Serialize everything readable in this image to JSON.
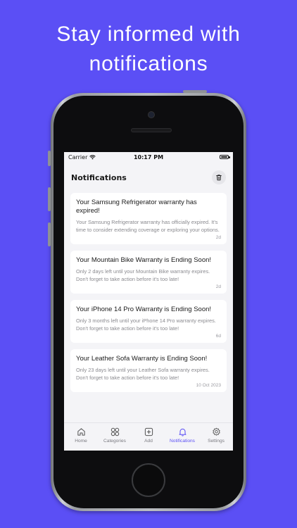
{
  "promo": {
    "headline_line1": "Stay informed with",
    "headline_line2": "notifications"
  },
  "statusbar": {
    "carrier": "Carrier",
    "time": "10:17 PM"
  },
  "header": {
    "title": "Notifications",
    "clear_icon": "trash-icon"
  },
  "notifications": [
    {
      "title": "Your Samsung Refrigerator warranty has expired!",
      "body": "Your Samsung Refrigerator warranty has officially expired. It's time to consider extending coverage or exploring your options.",
      "time": "2d"
    },
    {
      "title": "Your Mountain Bike Warranty is Ending Soon!",
      "body": "Only 2 days left until your Mountain Bike warranty expires. Don't forget to take action before it's too late!",
      "time": "2d"
    },
    {
      "title": "Your iPhone 14 Pro Warranty is Ending Soon!",
      "body": "Only 3 months left until your iPhone 14 Pro warranty expires. Don't forget to take action before it's too late!",
      "time": "6d"
    },
    {
      "title": "Your Leather Sofa Warranty is Ending Soon!",
      "body": "Only 23 days left until your Leather Sofa warranty expires. Don't forget to take action before it's too late!",
      "time": "10 Oct 2023"
    }
  ],
  "tabs": [
    {
      "label": "Home",
      "icon": "home-icon"
    },
    {
      "label": "Categories",
      "icon": "grid-icon"
    },
    {
      "label": "Add",
      "icon": "plus-square-icon"
    },
    {
      "label": "Notifications",
      "icon": "bell-icon",
      "active": true
    },
    {
      "label": "Settings",
      "icon": "gear-icon"
    }
  ],
  "colors": {
    "background": "#5b4ff5",
    "accent": "#5b4ff5"
  }
}
